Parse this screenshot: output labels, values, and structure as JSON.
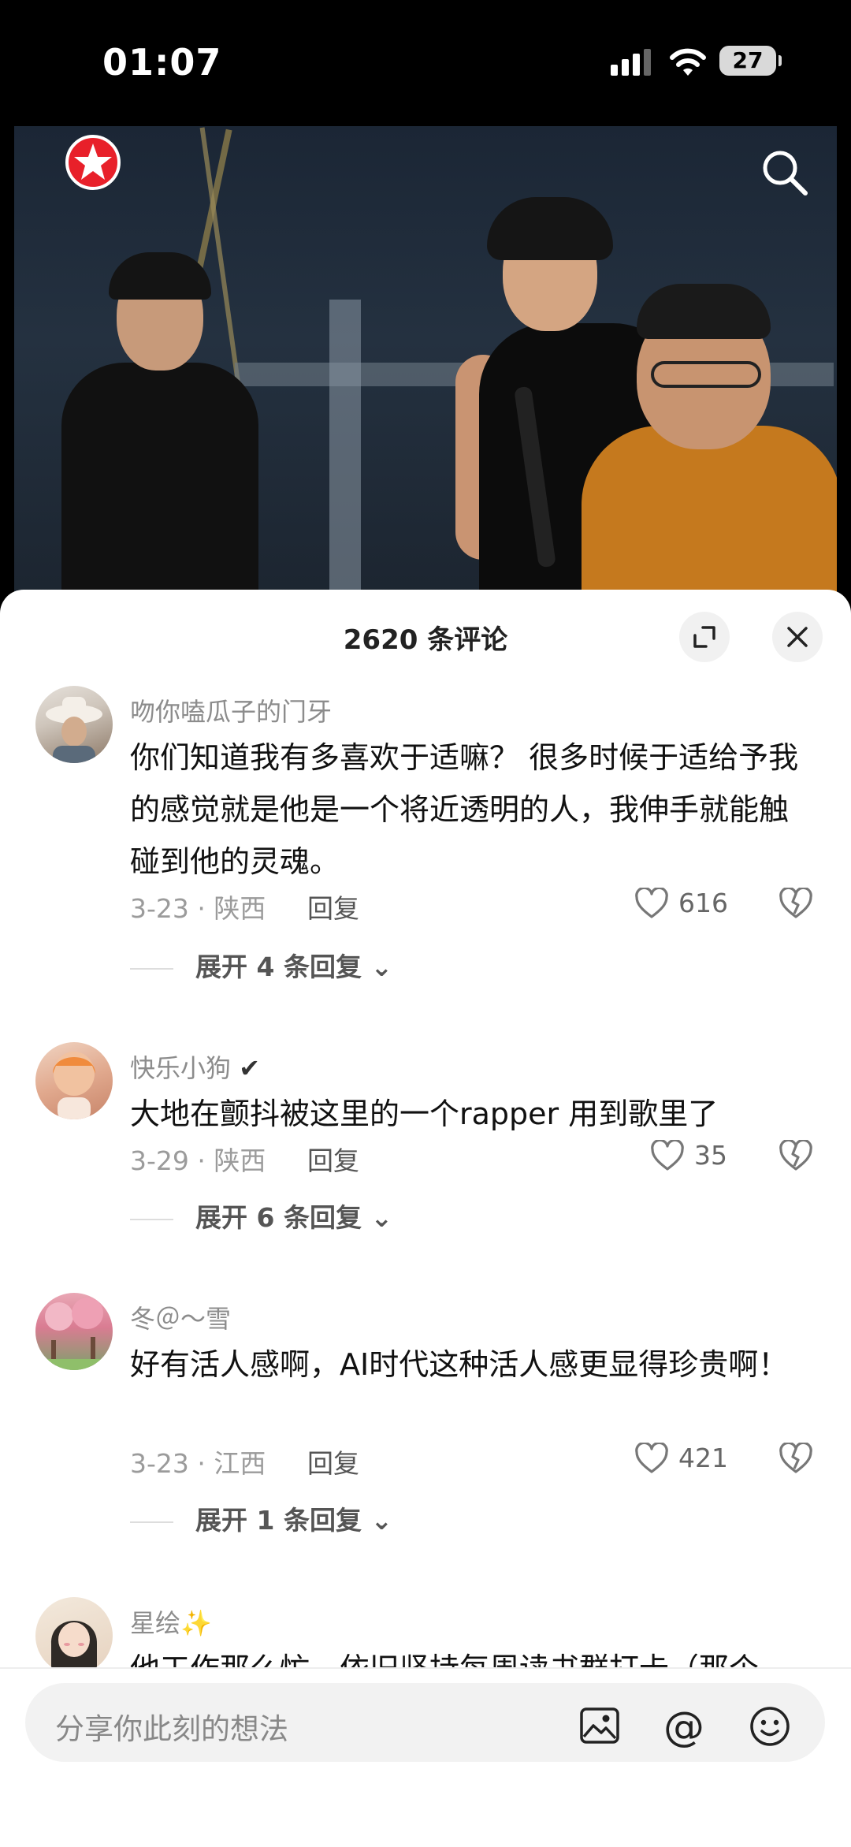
{
  "status_bar": {
    "time": "01:07",
    "battery": "27"
  },
  "video": {
    "logo": "star-channel-logo",
    "search_icon": "search-icon"
  },
  "comments_sheet": {
    "title": "2620 条评论",
    "expand_icon": "expand-icon",
    "close_icon": "close-icon",
    "comments": [
      {
        "username": "吻你嗑瓜子的门牙",
        "text": "你们知道我有多喜欢于适嘛？ 很多时候于适给予我的感觉就是他是一个将近透明的人，我伸手就能触碰到他的灵魂。",
        "meta": "3-23 · 陕西",
        "reply": "回复",
        "likes": "616",
        "expand": "展开 4 条回复"
      },
      {
        "username": "快乐小狗",
        "username_badge": "✔",
        "text": "大地在颤抖被这里的一个rapper 用到歌里了",
        "meta": "3-29 · 陕西",
        "reply": "回复",
        "likes": "35",
        "expand": "展开 6 条回复"
      },
      {
        "username": "冬＠～雪",
        "text": "好有活人感啊，AI时代这种活人感更显得珍贵啊！",
        "meta": "3-23 · 江西",
        "reply": "回复",
        "likes": "421",
        "expand": "展开 1 条回复"
      },
      {
        "username": "星绘",
        "username_badge": "✨",
        "text": "他工作那么忙，依旧坚持每周读书群打卡（那个"
      }
    ]
  },
  "input_bar": {
    "placeholder": "分享你此刻的想法",
    "at_symbol": "@"
  },
  "colors": {
    "accent_red": "#e8202a",
    "sheet_bg": "#ffffff",
    "muted_text": "#9b9b9b"
  }
}
